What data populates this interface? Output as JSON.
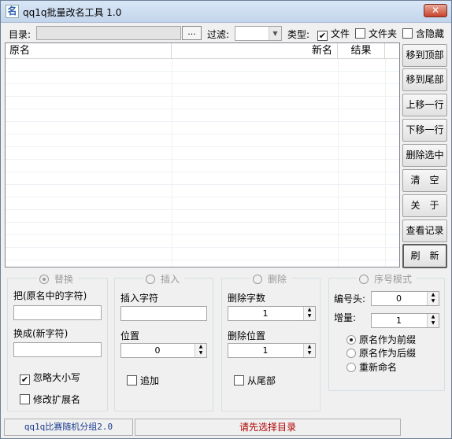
{
  "window": {
    "title": "qq1q批量改名工具 1.0",
    "close_label": "✕",
    "app_icon_glyph": "名"
  },
  "toolbar": {
    "dir_label": "目录:",
    "browse_label": "...",
    "filter_label": "过滤:",
    "filter_value": "",
    "type_label": "类型:",
    "file_label": "文件",
    "file_checked": true,
    "folder_label": "文件夹",
    "folder_checked": false,
    "hidden_label": "含隐藏",
    "hidden_checked": false
  },
  "list": {
    "columns": [
      "原名",
      "新名",
      "结果"
    ]
  },
  "side_buttons": [
    "移到顶部",
    "移到尾部",
    "上移一行",
    "下移一行",
    "删除选中",
    "清　空",
    "关　于",
    "查看记录",
    "刷　新"
  ],
  "replace": {
    "title": "替换",
    "selected": true,
    "from_label": "把(原名中的字符)",
    "from_value": "",
    "to_label": "换成(新字符)",
    "to_value": "",
    "ignore_case_label": "忽略大小写",
    "ignore_case_checked": true,
    "modify_ext_label": "修改扩展名",
    "modify_ext_checked": false
  },
  "insert": {
    "title": "插入",
    "selected": false,
    "text_label": "插入字符",
    "text_value": "",
    "position_label": "位置",
    "position_value": "0",
    "append_label": "追加",
    "append_checked": false
  },
  "delete": {
    "title": "删除",
    "selected": false,
    "count_label": "删除字数",
    "count_value": "1",
    "position_label": "删除位置",
    "position_value": "1",
    "from_end_label": "从尾部",
    "from_end_checked": false
  },
  "sequence": {
    "title": "序号模式",
    "selected": false,
    "prefix_label": "编号头:",
    "prefix_value": "0",
    "increment_label": "增量:",
    "increment_value": "1",
    "options": [
      "原名作为前缀",
      "原名作为后缀",
      "重新命名"
    ],
    "selected_option": 0
  },
  "status": {
    "left_text": "qq1q比赛随机分组2.0",
    "right_text": "请先选择目录"
  }
}
